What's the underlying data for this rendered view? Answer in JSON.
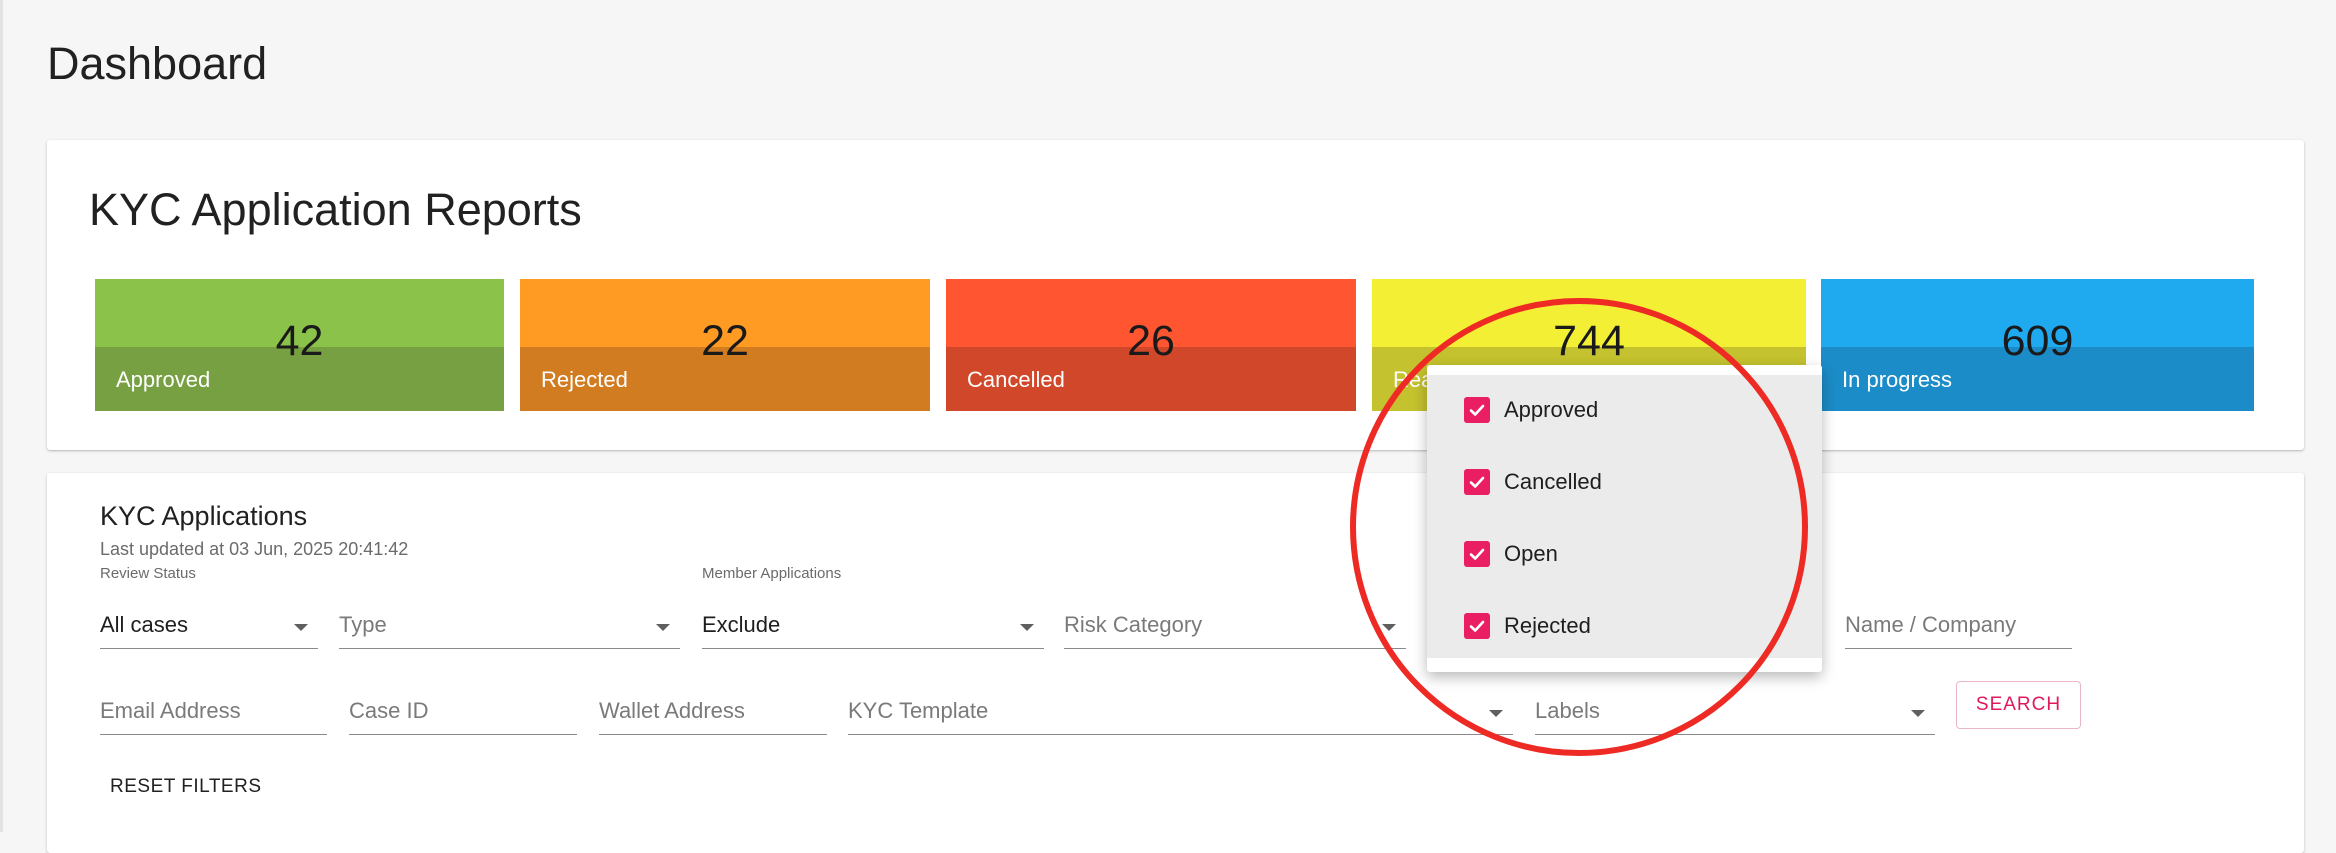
{
  "page": {
    "title": "Dashboard"
  },
  "reports": {
    "title": "KYC Application Reports",
    "tiles": [
      {
        "label": "Approved",
        "count": "42"
      },
      {
        "label": "Rejected",
        "count": "22"
      },
      {
        "label": "Cancelled",
        "count": "26"
      },
      {
        "label": "Rea",
        "count": "744"
      },
      {
        "label": "In progress",
        "count": "609"
      }
    ],
    "colors": {
      "approved": "#8bc34a",
      "rejected": "#ff9a23",
      "cancelled": "#ff5631",
      "ready": "#f2ef35",
      "in_progress": "#1faaf0"
    }
  },
  "applications": {
    "title": "KYC Applications",
    "last_updated": "Last updated at 03 Jun, 2025 20:41:42",
    "filters": {
      "review_status": {
        "label": "Review Status",
        "value": "All cases"
      },
      "type": {
        "placeholder": "Type"
      },
      "member_applications": {
        "label": "Member Applications",
        "value": "Exclude"
      },
      "risk_category": {
        "placeholder": "Risk Category"
      },
      "name_company": {
        "placeholder": "Name / Company"
      },
      "email_address": {
        "placeholder": "Email Address"
      },
      "case_id": {
        "placeholder": "Case ID"
      },
      "wallet_address": {
        "placeholder": "Wallet Address"
      },
      "kyc_template": {
        "placeholder": "KYC Template"
      },
      "labels": {
        "placeholder": "Labels"
      }
    },
    "search_label": "SEARCH",
    "reset_label": "RESET FILTERS"
  },
  "dropdown": {
    "options": [
      {
        "label": "Approved",
        "checked": true
      },
      {
        "label": "Cancelled",
        "checked": true
      },
      {
        "label": "Open",
        "checked": true
      },
      {
        "label": "Rejected",
        "checked": true
      }
    ],
    "accent": "#e91e63"
  },
  "annotation": {
    "ring_color": "#ee2a24"
  }
}
